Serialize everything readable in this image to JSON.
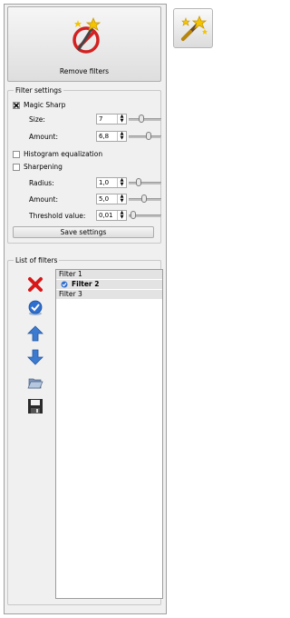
{
  "remove_filters": {
    "label": "Remove filters"
  },
  "filter_settings": {
    "title": "Filter settings",
    "magic_sharp": {
      "label": "Magic Sharp",
      "checked": true
    },
    "size": {
      "label": "Size:",
      "value": "7",
      "level": 0.35
    },
    "amount": {
      "label": "Amount:",
      "value": "6,8",
      "level": 0.62
    },
    "histogram_equalization": {
      "label": "Histogram equalization",
      "checked": false
    },
    "sharpening": {
      "label": "Sharpening",
      "checked": false
    },
    "radius": {
      "label": "Radius:",
      "value": "1,0",
      "level": 0.25
    },
    "sharp_amount": {
      "label": "Amount:",
      "value": "5,0",
      "level": 0.45
    },
    "threshold": {
      "label": "Threshold value:",
      "value": "0,01",
      "level": 0.05
    },
    "save_label": "Save settings"
  },
  "list_of_filters": {
    "title": "List of filters",
    "items": [
      {
        "label": "Filter 1"
      },
      {
        "label": "Filter 2"
      },
      {
        "label": "Filter 3"
      }
    ]
  },
  "colors": {
    "accent": "#3a7bd5",
    "delete": "#d81818",
    "panel": "#f0f0f0"
  }
}
